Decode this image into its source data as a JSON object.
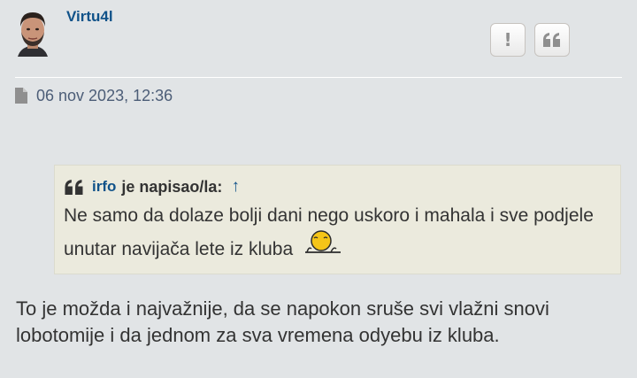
{
  "post": {
    "author": "Virtu4l",
    "date": "06 nov 2023, 12:36",
    "buttons": {
      "report_label": "!",
      "quote_icon": "quote-icon"
    },
    "quote": {
      "author": "irfo",
      "wrote": "je napisao/la:",
      "arrow": "↑",
      "text": "Ne samo da dolaze bolji dani nego uskoro i mahala i sve podjele unutar navijača lete iz kluba",
      "smiley": "waving-smiley-icon"
    },
    "body": "To je možda i najvažnije, da se napokon sruše svi vlažni snovi lobotomije i da jednom za sva vremena odyebu iz kluba."
  },
  "colors": {
    "background": "#e1e4e6",
    "link": "#105289",
    "quote_bg": "#ebeadd",
    "text": "#333333"
  }
}
